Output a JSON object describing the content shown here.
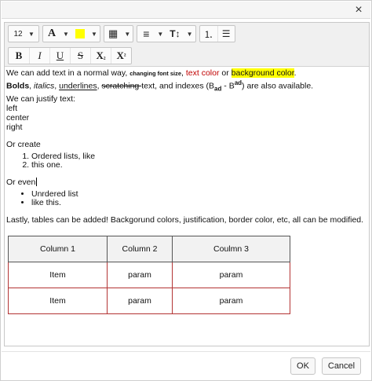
{
  "dialog": {
    "close_glyph": "×"
  },
  "toolbar": {
    "font_size": "12",
    "font_color_glyph": "A",
    "highlight_color": "#ffff00",
    "table_glyph": "▦",
    "align_glyph": "≡",
    "line_height_glyph": "T↕",
    "ordered_list_glyph": "⒈",
    "unordered_list_glyph": "☰",
    "bold_label": "B",
    "italic_label": "I",
    "underline_label": "U",
    "strike_label": "S",
    "subscript_label": "X",
    "subscript_mark": "₂",
    "superscript_label": "X",
    "superscript_mark": "²",
    "caret": "▼"
  },
  "content": {
    "line1_a": "We can add text in a normal way, ",
    "line1_small": "changing font size",
    "line1_b": ", ",
    "line1_red": "text color",
    "line1_c": " or ",
    "line1_hl": "background color",
    "line1_d": ".",
    "line2_bold": "Bolds",
    "line2_a": ", ",
    "line2_italic": "italics",
    "line2_b": ", ",
    "line2_underline": "underlines",
    "line2_c": ", ",
    "line2_strike": "scratching ",
    "line2_d": "text, and indexes (B",
    "line2_sub": "ad",
    "line2_e": " - B",
    "line2_sup": "ad",
    "line2_f": ") are also available.",
    "justify_intro": "We can justify text:",
    "left": "left",
    "center": "center",
    "right": "right",
    "or_create": "Or create",
    "ordered_items": [
      "Ordered lists, like",
      "this one."
    ],
    "or_even": "Or even",
    "unordered_items": [
      "Unrdered list",
      "like this."
    ],
    "tables_line": "Lastly, tables can be added! Backgorund colors, justification, border color, etc, all can be modified."
  },
  "table": {
    "headers": [
      "Column 1",
      "Column 2",
      "Coulmn 3"
    ],
    "rows": [
      [
        "Item",
        "param",
        "param"
      ],
      [
        "Item",
        "param",
        "param"
      ]
    ],
    "border_color": "#b33333"
  },
  "footer": {
    "ok_label": "OK",
    "cancel_label": "Cancel"
  }
}
